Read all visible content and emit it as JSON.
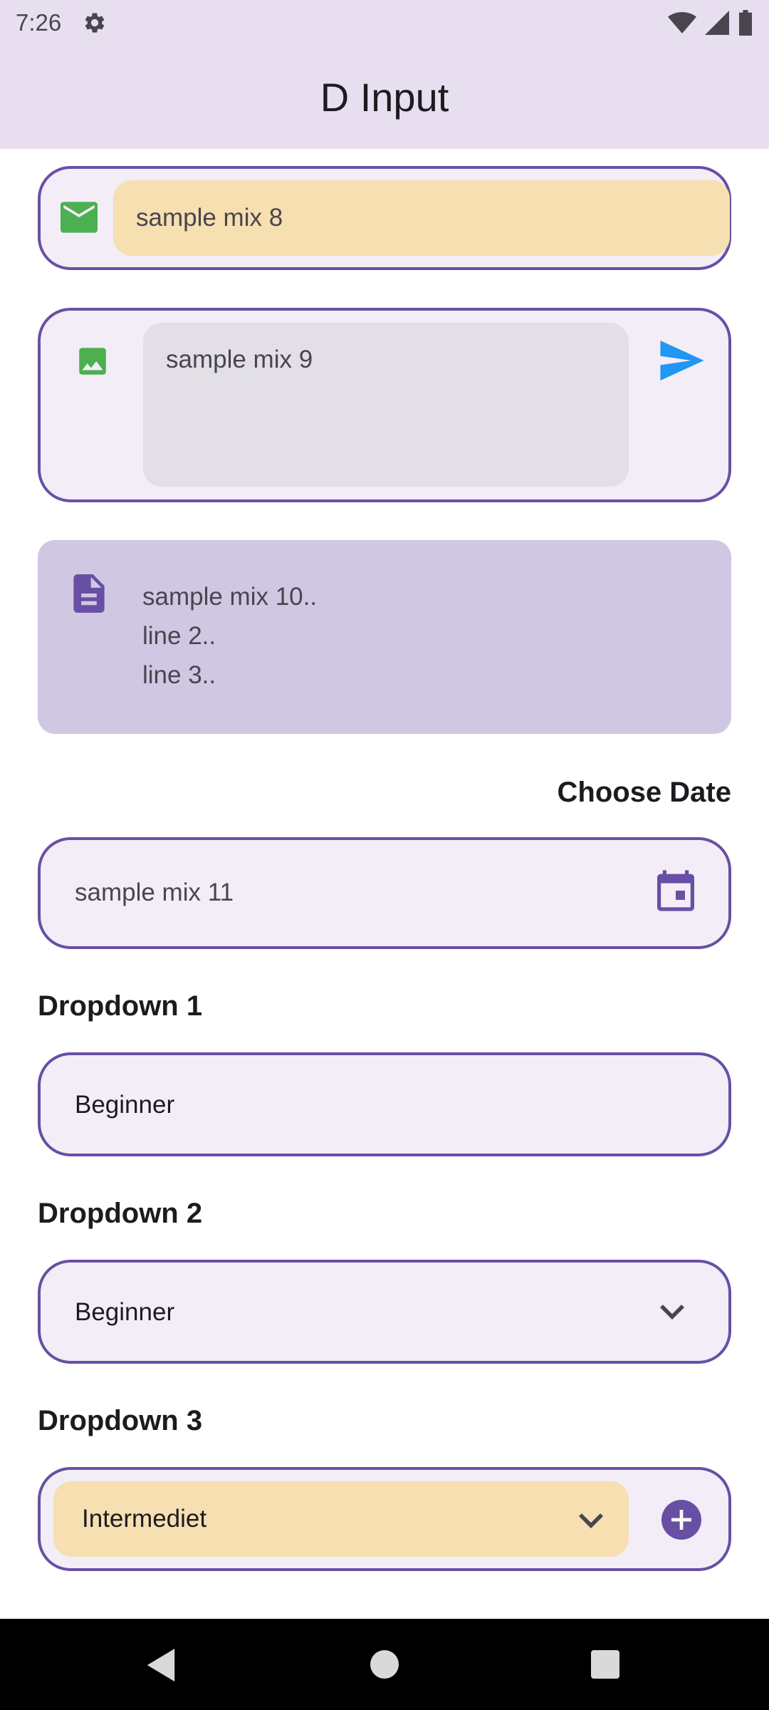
{
  "status_bar": {
    "time": "7:26"
  },
  "app_bar": {
    "title": "D Input"
  },
  "fields": {
    "mix8": {
      "value": "sample mix 8",
      "icon": "mail-icon",
      "icon_color": "#4caf50",
      "fill_color": "#f6dfb0"
    },
    "mix9": {
      "value": "sample mix 9",
      "icon": "image-icon",
      "icon_color": "#4caf50",
      "action_icon": "send-icon",
      "action_color": "#2196f3"
    },
    "mix10": {
      "lines": [
        "sample mix 10..",
        "line 2..",
        "line 3.."
      ],
      "icon": "document-icon",
      "icon_color": "#6750a4"
    },
    "date": {
      "label": "Choose Date",
      "value": "sample mix 11",
      "icon": "calendar-icon"
    }
  },
  "dropdowns": [
    {
      "label": "Dropdown 1",
      "value": "Beginner"
    },
    {
      "label": "Dropdown 2",
      "value": "Beginner",
      "icon": "chevron-down-icon"
    },
    {
      "label": "Dropdown 3",
      "value": "Intermediet",
      "icon": "chevron-down-icon",
      "action_icon": "add-circle-icon",
      "fill_color": "#f6dfb0"
    }
  ],
  "colors": {
    "accent": "#6750a4",
    "app_bar": "#e7dff0",
    "field_bg": "#f3edf7"
  }
}
